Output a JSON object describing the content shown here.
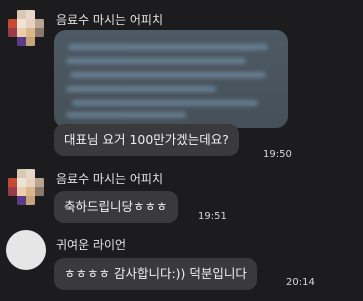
{
  "messages": [
    {
      "sender": "음료수 마시는 어피치",
      "avatar": "peach-pixel-avatar-icon",
      "attachment": "blurred-image-preview",
      "text": "대표님 요거 100만가겠는데요?",
      "time": "19:50"
    },
    {
      "sender": "음료수 마시는 어피치",
      "avatar": "peach-pixel-avatar-icon",
      "text": "축하드립니당ㅎㅎㅎ",
      "time": "19:51"
    },
    {
      "sender": "귀여운 라이언",
      "avatar": "default-avatar-icon",
      "text": "ㅎㅎㅎㅎ 감사합니다:)) 덕분입니다",
      "time": "20:14"
    }
  ],
  "colors": {
    "background": "#1c1c1e",
    "bubble": "#3a3a3c",
    "attachment": "#4d5964"
  }
}
